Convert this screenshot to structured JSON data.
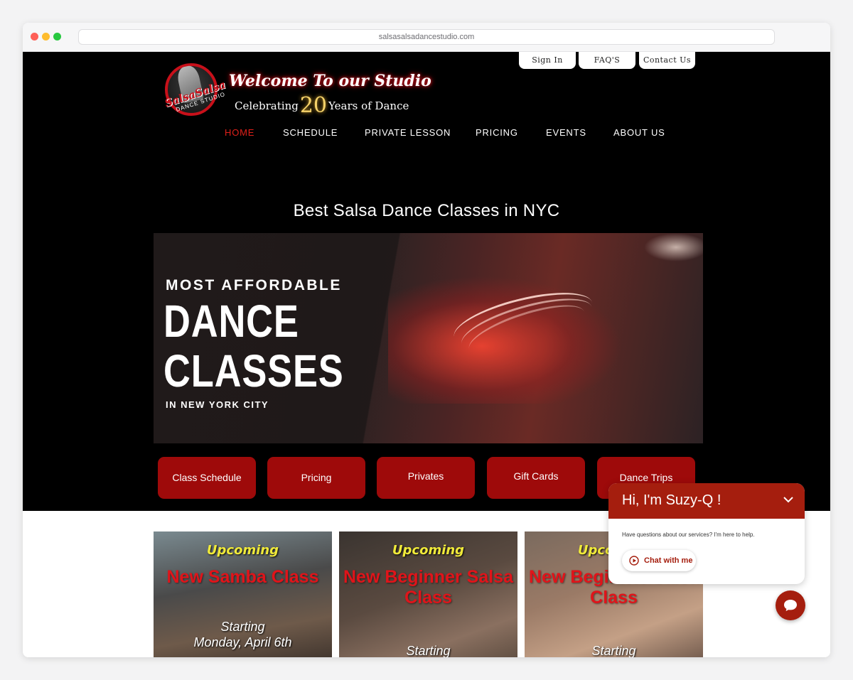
{
  "browser": {
    "url": "salsasalsadancestudio.com"
  },
  "header": {
    "logo_name": "SalsaSalsa",
    "logo_sub": "DANCE STUDIO",
    "welcome": "Welcome To our Studio",
    "celebrating_pre": "Celebrating",
    "celebrating_num": "20",
    "celebrating_post": "Years of Dance",
    "top_links": {
      "sign_in": "Sign In",
      "faq": "FAQ'S",
      "contact": "Contact Us"
    }
  },
  "nav": {
    "items": [
      "HOME",
      "SCHEDULE",
      "PRIVATE LESSON",
      "PRICING",
      "EVENTS",
      "ABOUT US"
    ],
    "active": "HOME"
  },
  "main": {
    "heading": "Best Salsa Dance Classes in NYC",
    "banner": {
      "line1": "MOST AFFORDABLE",
      "line2": "DANCE",
      "line3": "CLASSES",
      "line4": "IN NEW YORK CITY"
    },
    "buttons": [
      "Class Schedule",
      "Pricing",
      "Privates",
      "Gift Cards",
      "Dance Trips"
    ]
  },
  "cards": [
    {
      "upcoming": "Upcoming",
      "name": "New Samba Class",
      "starting": "Starting",
      "date": "Monday, April 6th"
    },
    {
      "upcoming": "Upcoming",
      "name": "New Beginner Salsa Class",
      "starting": "Starting"
    },
    {
      "upcoming": "Upcoming",
      "name": "New Beginner Salsa Class",
      "starting": "Starting"
    }
  ],
  "chat": {
    "title": "Hi, I'm Suzy-Q !",
    "message": "Have questions about our services? I'm here to help.",
    "button": "Chat with me"
  },
  "colors": {
    "brand_red": "#9e0a0a",
    "chat_red": "#a51e0e",
    "nav_active": "#e0201a",
    "upcoming_yellow": "#f0ea3a"
  }
}
